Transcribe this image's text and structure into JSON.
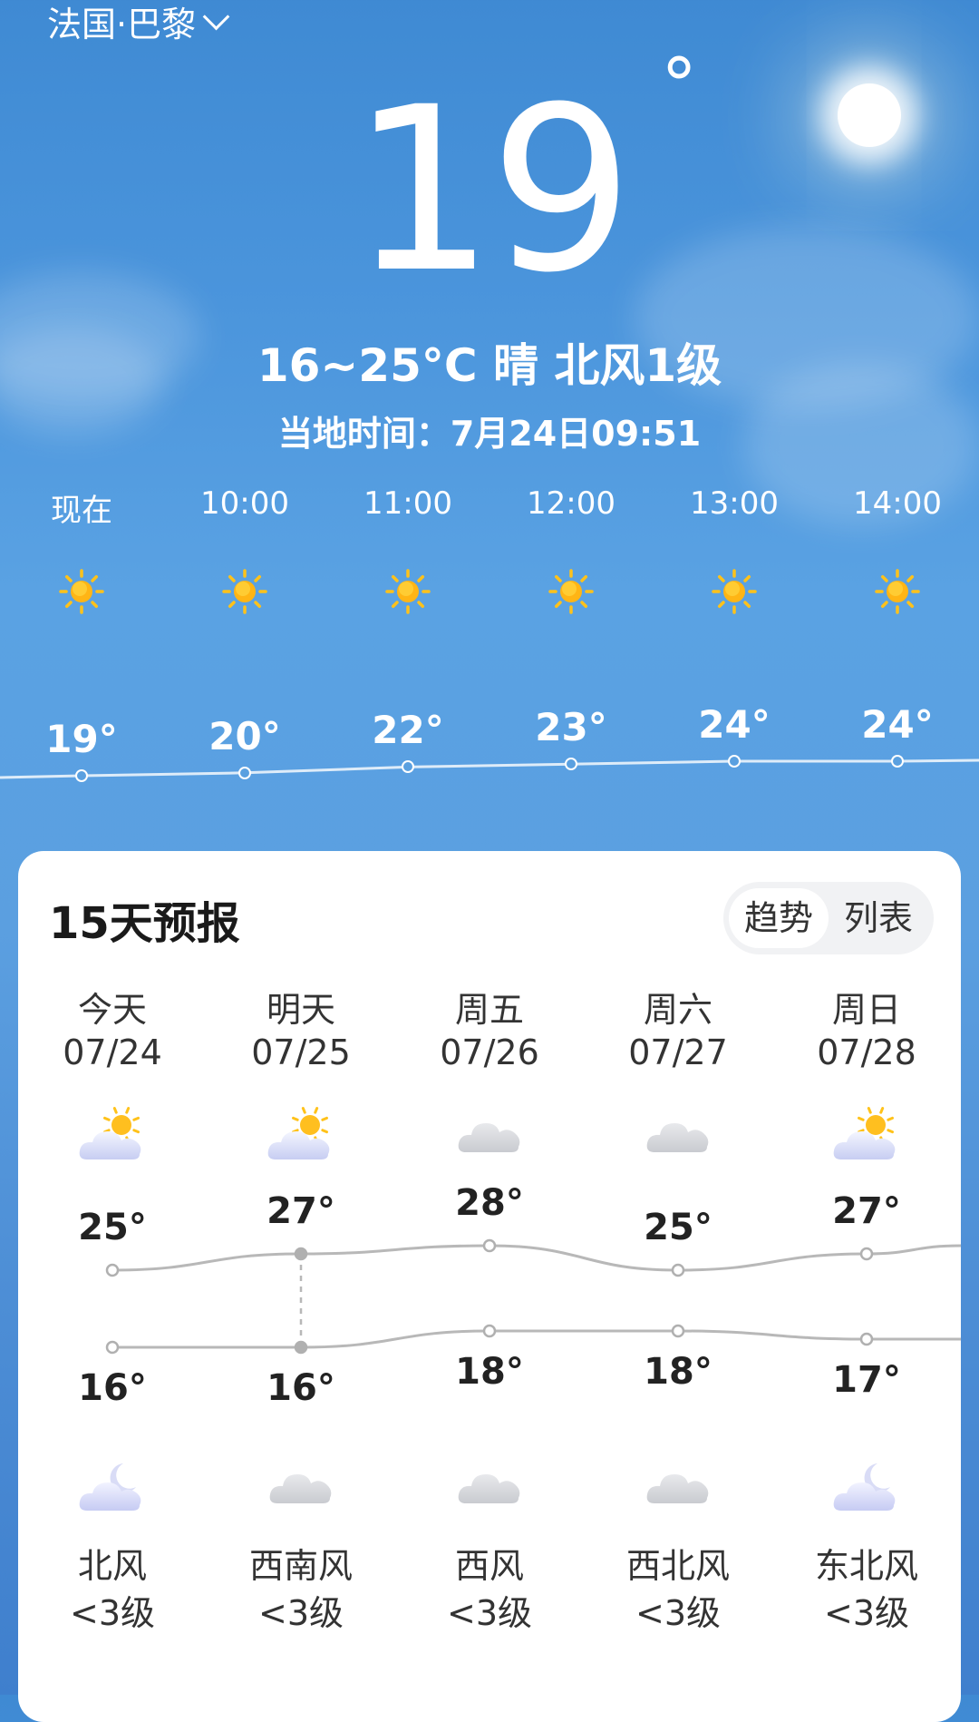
{
  "location": {
    "name": "法国·巴黎"
  },
  "current": {
    "temp": "19",
    "degree_symbol": "°",
    "summary": "16~25°C 晴 北风1级",
    "local_time_label": "当地时间：",
    "local_time": "7月24日09:51"
  },
  "hourly": [
    {
      "time": "现在",
      "icon": "sun-icon",
      "temp": "19°",
      "value": 19
    },
    {
      "time": "10:00",
      "icon": "sun-icon",
      "temp": "20°",
      "value": 20
    },
    {
      "time": "11:00",
      "icon": "sun-icon",
      "temp": "22°",
      "value": 22
    },
    {
      "time": "12:00",
      "icon": "sun-icon",
      "temp": "23°",
      "value": 23
    },
    {
      "time": "13:00",
      "icon": "sun-icon",
      "temp": "24°",
      "value": 24
    },
    {
      "time": "14:00",
      "icon": "sun-icon",
      "temp": "24°",
      "value": 24
    }
  ],
  "forecast": {
    "title": "15天预报",
    "toggle": {
      "trend": "趋势",
      "list": "列表",
      "active": "trend"
    },
    "days": [
      {
        "name": "今天",
        "date": "07/24",
        "day_icon": "partly-cloudy-icon",
        "high": "25°",
        "high_value": 25,
        "low": "16°",
        "low_value": 16,
        "night_icon": "moon-cloud-icon",
        "wind": "北风",
        "wind_level": "<3级"
      },
      {
        "name": "明天",
        "date": "07/25",
        "day_icon": "partly-cloudy-icon",
        "high": "27°",
        "high_value": 27,
        "low": "16°",
        "low_value": 16,
        "night_icon": "cloud-icon",
        "wind": "西南风",
        "wind_level": "<3级"
      },
      {
        "name": "周五",
        "date": "07/26",
        "day_icon": "cloud-icon",
        "high": "28°",
        "high_value": 28,
        "low": "18°",
        "low_value": 18,
        "night_icon": "cloud-icon",
        "wind": "西风",
        "wind_level": "<3级"
      },
      {
        "name": "周六",
        "date": "07/27",
        "day_icon": "cloud-icon",
        "high": "25°",
        "high_value": 25,
        "low": "18°",
        "low_value": 18,
        "night_icon": "cloud-icon",
        "wind": "西北风",
        "wind_level": "<3级"
      },
      {
        "name": "周日",
        "date": "07/28",
        "day_icon": "partly-cloudy-icon",
        "high": "27°",
        "high_value": 27,
        "low": "17°",
        "low_value": 17,
        "night_icon": "moon-cloud-icon",
        "wind": "东北风",
        "wind_level": "<3级"
      }
    ]
  },
  "colors": {
    "sky_top": "#3f8ad3",
    "sun_yellow": "#ffc21a",
    "trend_line": "#b5b5b5",
    "card_bg": "#ffffff"
  }
}
